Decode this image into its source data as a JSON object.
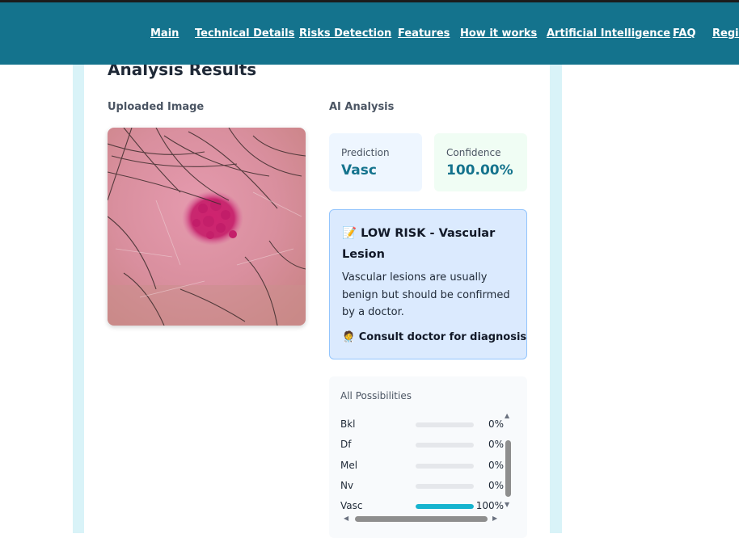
{
  "nav": {
    "links": [
      "Main",
      "Technical Details",
      "Risks Detection",
      "Features",
      "How it works",
      "Artificial Intelligence",
      "FAQ",
      "Regis"
    ]
  },
  "results": {
    "title": "Analysis Results",
    "uploaded_label": "Uploaded Image",
    "analysis_label": "AI Analysis"
  },
  "prediction": {
    "label": "Prediction",
    "value": "Vasc"
  },
  "confidence": {
    "label": "Confidence",
    "value": "100.00%"
  },
  "risk": {
    "icon": "memo-emoji-icon",
    "title": "LOW RISK - Vascular Lesion",
    "description": "Vascular lesions are usually benign but should be confirmed by a doctor.",
    "consult_icon": "health-worker-emoji-icon",
    "consult": "Consult doctor for diagnosis"
  },
  "possibilities": {
    "title": "All Possibilities",
    "items": [
      {
        "label": "Bkl",
        "value": 0,
        "pct": "0%"
      },
      {
        "label": "Df",
        "value": 0,
        "pct": "0%"
      },
      {
        "label": "Mel",
        "value": 0,
        "pct": "0%"
      },
      {
        "label": "Nv",
        "value": 0,
        "pct": "0%"
      },
      {
        "label": "Vasc",
        "value": 100,
        "pct": "100%"
      }
    ]
  },
  "colors": {
    "navbar": "#14738d",
    "accent": "#16b4cf",
    "risk_background": "#dbeafe",
    "confidence_background": "#f0fdf4",
    "prediction_background": "#eef6ff"
  }
}
